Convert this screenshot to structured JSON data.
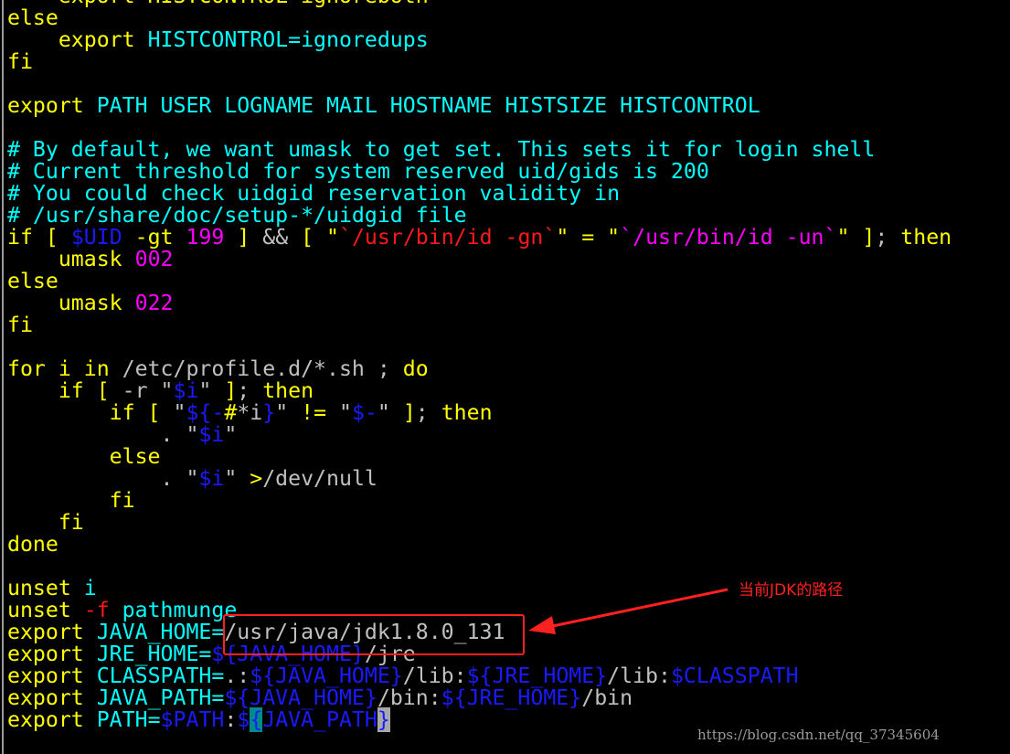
{
  "colors": {
    "keyword": "#ffff00",
    "identifier": "#00ffff",
    "plain": "#c0c0c0",
    "variable": "#1a1aff",
    "number": "#ff00ff",
    "special": "#ff1a1a",
    "annotation": "#ff2020"
  },
  "lines": [
    [
      [
        "    export HISTCONTROL=ignoreboth",
        "y"
      ]
    ],
    [
      [
        "else",
        "y"
      ]
    ],
    [
      [
        "    export ",
        "y"
      ],
      [
        "HISTCONTROL=ignoredups",
        "c"
      ]
    ],
    [
      [
        "fi",
        "y"
      ]
    ],
    [],
    [
      [
        "export",
        "y"
      ],
      [
        " PATH USER LOGNAME MAIL HOSTNAME HISTSIZE HISTCONTROL",
        "c"
      ]
    ],
    [],
    [
      [
        "# By default, we want umask to get set. This sets it for login shell",
        "c"
      ]
    ],
    [
      [
        "# Current threshold for system reserved uid/gids is 200",
        "c"
      ]
    ],
    [
      [
        "# You could check uidgid reservation validity in",
        "c"
      ]
    ],
    [
      [
        "# /usr/share/doc/setup-*/uidgid file",
        "c"
      ]
    ],
    [
      [
        "if [ ",
        "y"
      ],
      [
        "$UID",
        "b"
      ],
      [
        " -gt ",
        "y"
      ],
      [
        "199",
        "m"
      ],
      [
        " ] ",
        "y"
      ],
      [
        "&&",
        "g"
      ],
      [
        " [ \"",
        "y"
      ],
      [
        "`/usr/bin/id -gn`",
        "r"
      ],
      [
        "\" = \"",
        "y"
      ],
      [
        "`/usr/bin/id -un`",
        "m"
      ],
      [
        "\" ]",
        "y"
      ],
      [
        ";",
        "g"
      ],
      [
        " then",
        "y"
      ]
    ],
    [
      [
        "    umask ",
        "y"
      ],
      [
        "002",
        "m"
      ]
    ],
    [
      [
        "else",
        "y"
      ]
    ],
    [
      [
        "    umask ",
        "y"
      ],
      [
        "022",
        "m"
      ]
    ],
    [
      [
        "fi",
        "y"
      ]
    ],
    [],
    [
      [
        "for i in ",
        "y"
      ],
      [
        "/etc/profile.d/*.sh ; ",
        "g"
      ],
      [
        "do",
        "y"
      ]
    ],
    [
      [
        "    if [ ",
        "y"
      ],
      [
        "-r \"",
        "g"
      ],
      [
        "$i",
        "b"
      ],
      [
        "\"",
        "g"
      ],
      [
        " ]",
        "y"
      ],
      [
        ";",
        "g"
      ],
      [
        " then",
        "y"
      ]
    ],
    [
      [
        "        if [ ",
        "y"
      ],
      [
        "\"",
        "g"
      ],
      [
        "${-",
        "b"
      ],
      [
        "#",
        "y"
      ],
      [
        "*i",
        "g"
      ],
      [
        "}",
        "b"
      ],
      [
        "\" ",
        "g"
      ],
      [
        "!=",
        "y"
      ],
      [
        " \"",
        "g"
      ],
      [
        "$-",
        "b"
      ],
      [
        "\"",
        "g"
      ],
      [
        " ]",
        "y"
      ],
      [
        ";",
        "g"
      ],
      [
        " then",
        "y"
      ]
    ],
    [
      [
        "            . \"",
        "g"
      ],
      [
        "$i",
        "b"
      ],
      [
        "\"",
        "g"
      ]
    ],
    [
      [
        "        else",
        "y"
      ]
    ],
    [
      [
        "            . \"",
        "g"
      ],
      [
        "$i",
        "b"
      ],
      [
        "\" ",
        "g"
      ],
      [
        ">",
        "y"
      ],
      [
        "/dev/null",
        "g"
      ]
    ],
    [
      [
        "        fi",
        "y"
      ]
    ],
    [
      [
        "    fi",
        "y"
      ]
    ],
    [
      [
        "done",
        "y"
      ]
    ],
    [],
    [
      [
        "unset",
        "y"
      ],
      [
        " i",
        "c"
      ]
    ],
    [
      [
        "unset",
        "y"
      ],
      [
        " -f",
        "r"
      ],
      [
        " pathmunge",
        "c"
      ]
    ],
    [
      [
        "export",
        "y"
      ],
      [
        " JAVA_HOME=",
        "c"
      ],
      [
        "/usr/java/jdk1.8.0_131",
        "g"
      ]
    ],
    [
      [
        "export",
        "y"
      ],
      [
        " JRE_HOME=",
        "c"
      ],
      [
        "${JAVA_HOME}",
        "b"
      ],
      [
        "/jre",
        "g"
      ]
    ],
    [
      [
        "export",
        "y"
      ],
      [
        " CLASSPATH=",
        "c"
      ],
      [
        ".:",
        "g"
      ],
      [
        "${JAVA_HOME}",
        "b"
      ],
      [
        "/lib:",
        "g"
      ],
      [
        "${JRE_HOME}",
        "b"
      ],
      [
        "/lib:",
        "g"
      ],
      [
        "$CLASSPATH",
        "b"
      ]
    ],
    [
      [
        "export",
        "y"
      ],
      [
        " JAVA_PATH=",
        "c"
      ],
      [
        "${JAVA_HOME}",
        "b"
      ],
      [
        "/bin:",
        "g"
      ],
      [
        "${JRE_HOME}",
        "b"
      ],
      [
        "/bin",
        "g"
      ]
    ],
    [
      [
        "export",
        "y"
      ],
      [
        " PATH=",
        "c"
      ],
      [
        "$PATH",
        "b"
      ],
      [
        ":",
        "g"
      ],
      [
        "$",
        "b"
      ],
      [
        "{",
        "b cur1"
      ],
      [
        "JAVA_PATH",
        "b"
      ],
      [
        "}",
        "b cur2"
      ]
    ]
  ],
  "annotation": {
    "note": "当前JDK的路径"
  },
  "watermark": "https://blog.csdn.net/qq_37345604"
}
